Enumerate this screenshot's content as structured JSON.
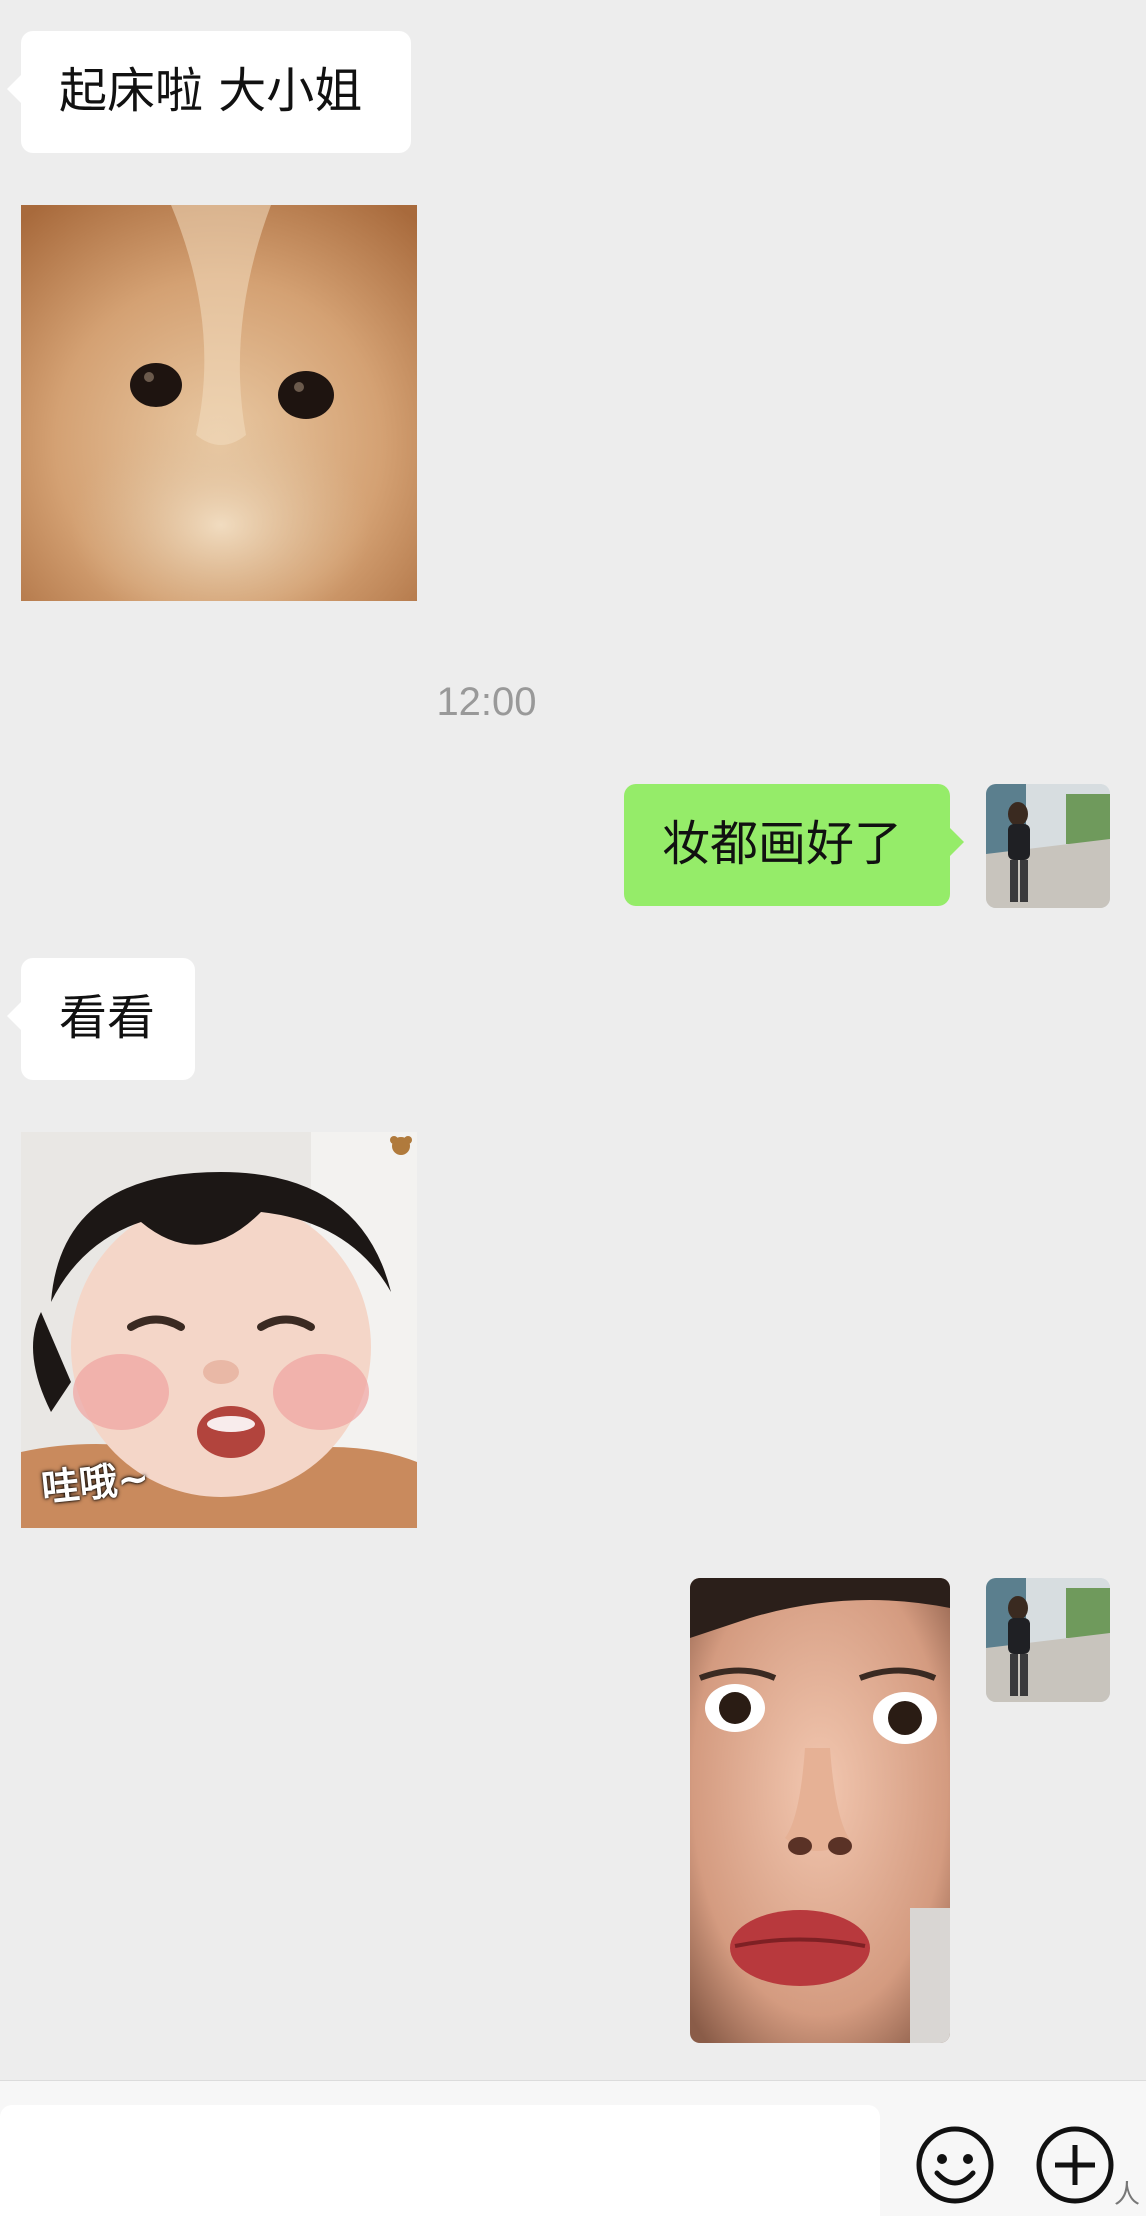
{
  "messages": [
    {
      "sender": "contact",
      "type": "text",
      "text": "起床啦 大小姐"
    },
    {
      "sender": "contact",
      "type": "sticker",
      "sticker": "dog-closeup-sticker"
    },
    {
      "type": "timestamp",
      "text": "12:00"
    },
    {
      "sender": "me",
      "type": "text",
      "text": "妆都画好了"
    },
    {
      "sender": "contact",
      "type": "text",
      "text": "看看"
    },
    {
      "sender": "contact",
      "type": "sticker",
      "sticker": "baby-face-sticker",
      "caption": "哇哦~"
    },
    {
      "sender": "me",
      "type": "image",
      "image": "pouting-face-selfie"
    }
  ],
  "input_bar": {
    "emoji_icon": "emoji-icon",
    "plus_icon": "plus-circle-icon"
  },
  "watermark": "人",
  "colors": {
    "background": "#ededed",
    "incoming_bubble": "#ffffff",
    "outgoing_bubble": "#95ec69",
    "timestamp": "#999999"
  }
}
